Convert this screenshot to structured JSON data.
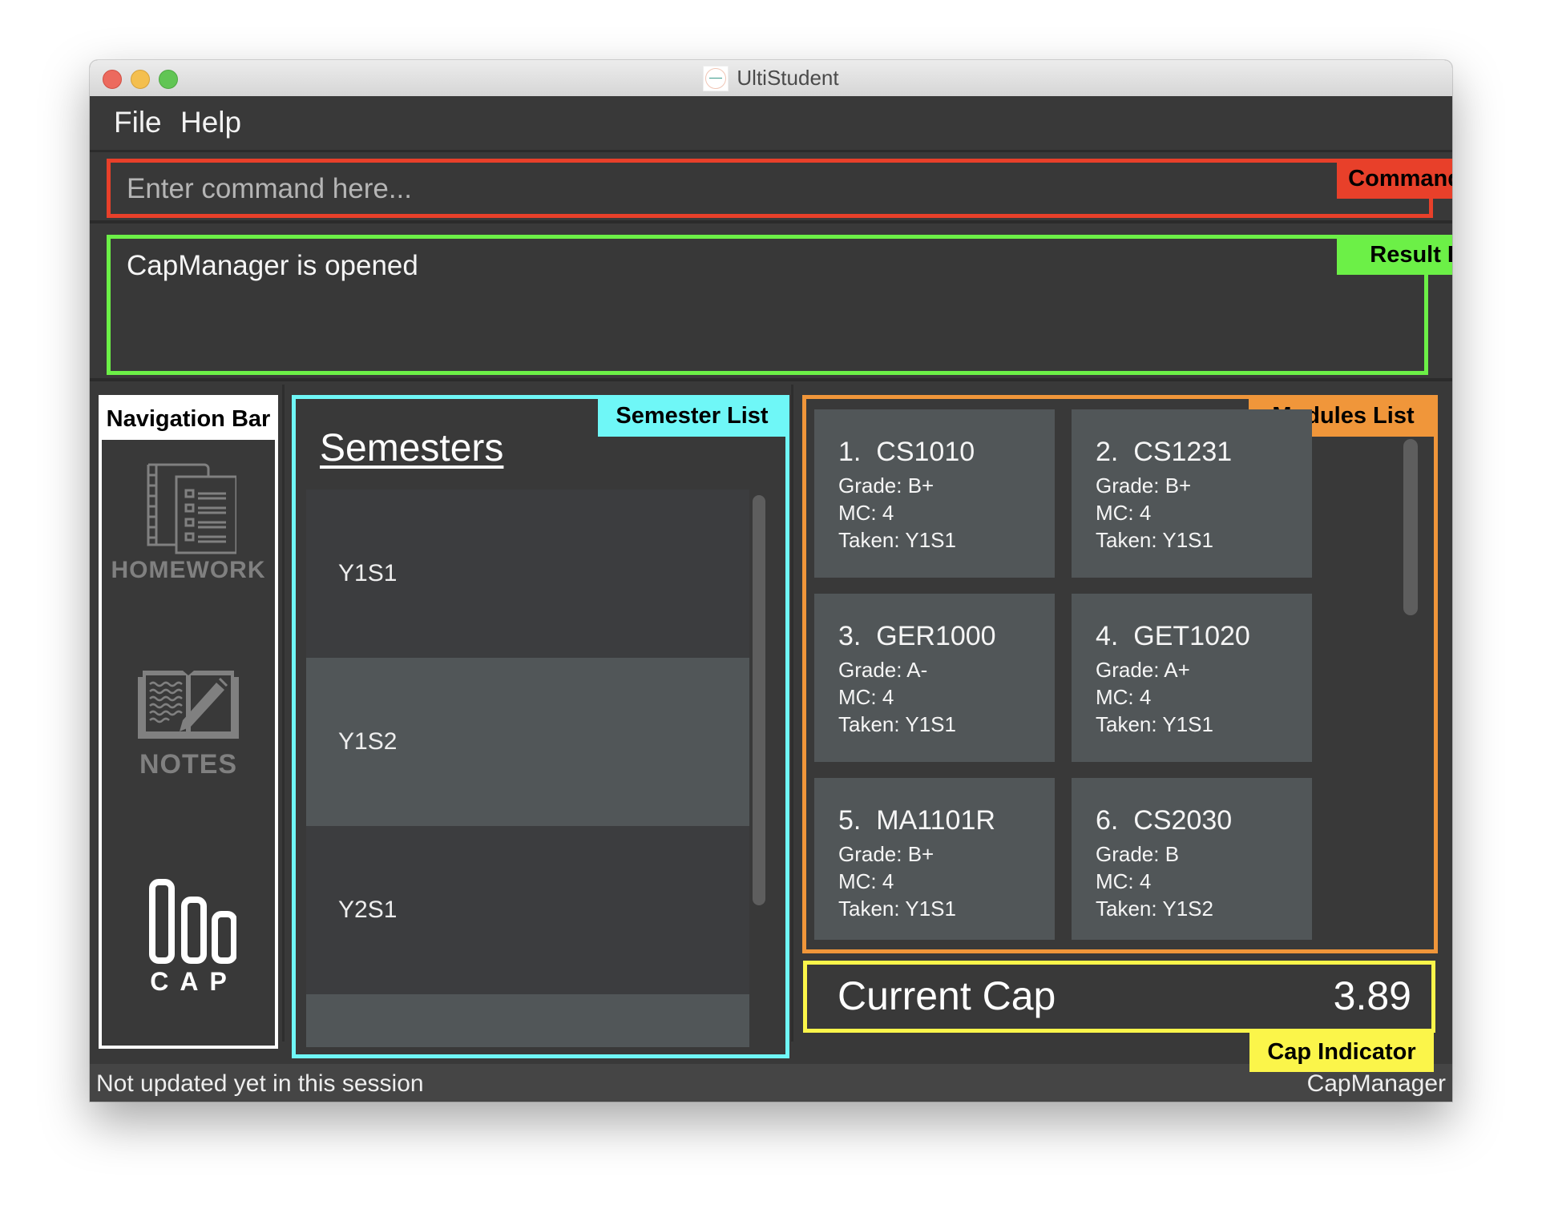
{
  "window": {
    "title": "UltiStudent"
  },
  "menu": {
    "items": [
      {
        "label": "File"
      },
      {
        "label": "Help"
      }
    ]
  },
  "command_box": {
    "placeholder": "Enter command here...",
    "value": "",
    "annotation": "Command Box"
  },
  "result_box": {
    "text": "CapManager is opened",
    "annotation": "Result Box"
  },
  "navigation": {
    "annotation": "Navigation Bar",
    "items": [
      {
        "label": "HOMEWORK",
        "icon": "homework-icon"
      },
      {
        "label": "NOTES",
        "icon": "notes-icon"
      },
      {
        "label": "CAP",
        "icon": "cap-icon"
      }
    ]
  },
  "semester_list": {
    "annotation": "Semester List",
    "title": "Semesters",
    "items": [
      {
        "label": "Y1S1"
      },
      {
        "label": "Y1S2"
      },
      {
        "label": "Y2S1"
      },
      {
        "label": ""
      }
    ]
  },
  "modules_list": {
    "annotation": "Modules List",
    "items": [
      {
        "index": "1.",
        "code": "CS1010",
        "grade": "Grade: B+",
        "mc": "MC: 4",
        "taken": "Taken: Y1S1"
      },
      {
        "index": "2.",
        "code": "CS1231",
        "grade": "Grade: B+",
        "mc": "MC: 4",
        "taken": "Taken: Y1S1"
      },
      {
        "index": "3.",
        "code": "GER1000",
        "grade": "Grade: A-",
        "mc": "MC: 4",
        "taken": "Taken: Y1S1"
      },
      {
        "index": "4.",
        "code": "GET1020",
        "grade": "Grade: A+",
        "mc": "MC: 4",
        "taken": "Taken: Y1S1"
      },
      {
        "index": "5.",
        "code": "MA1101R",
        "grade": "Grade: B+",
        "mc": "MC: 4",
        "taken": "Taken: Y1S1"
      },
      {
        "index": "6.",
        "code": "CS2030",
        "grade": "Grade: B",
        "mc": "MC: 4",
        "taken": "Taken: Y1S2"
      }
    ]
  },
  "cap_indicator": {
    "annotation": "Cap Indicator",
    "label": "Current Cap",
    "value": "3.89"
  },
  "status_bar": {
    "left": "Not updated yet in this session",
    "right": "CapManager"
  },
  "colors": {
    "command_box": "#e8402a",
    "result_box": "#6cf047",
    "navigation": "#ffffff",
    "semester_list": "#6ff7f7",
    "modules_list": "#f0963a",
    "cap_indicator": "#fbf54a",
    "background": "#393939"
  }
}
